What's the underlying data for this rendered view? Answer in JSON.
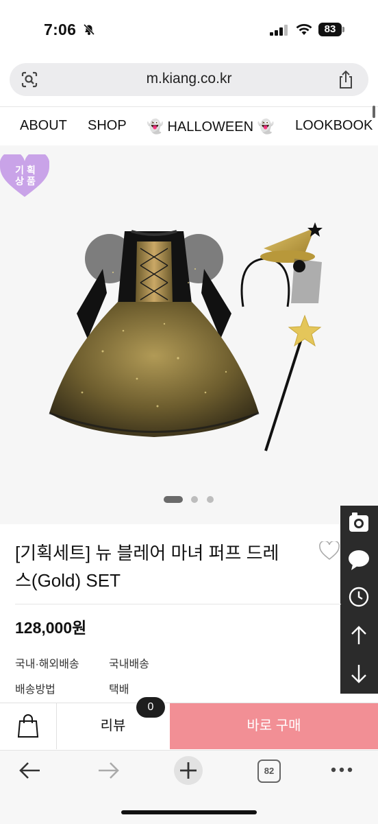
{
  "status_bar": {
    "time": "7:06",
    "battery": "83"
  },
  "browser": {
    "url": "m.kiang.co.kr",
    "tab_count": "82"
  },
  "nav": {
    "items": [
      "ABOUT",
      "SHOP",
      "👻 HALLOWEEN 👻",
      "LOOKBOOK"
    ]
  },
  "badge": {
    "line1": "기 획",
    "line2": "상 품"
  },
  "product": {
    "title_line1": "[기획세트] 뉴 블레어 마녀 퍼프 드레",
    "title_line2": "스(Gold) SET",
    "price": "128,000원",
    "info": [
      {
        "label": "국내·해외배송",
        "value": "국내배송"
      },
      {
        "label": "배송방법",
        "value": "택배"
      }
    ]
  },
  "buy_bar": {
    "review_label": "리뷰",
    "review_count": "0",
    "buy_label": "바로 구매"
  },
  "carousel": {
    "total": 3,
    "active": 1
  },
  "colors": {
    "buy_button": "#f28f95",
    "badge": "#c9a3e8",
    "side_panel": "#2b2b2b"
  }
}
